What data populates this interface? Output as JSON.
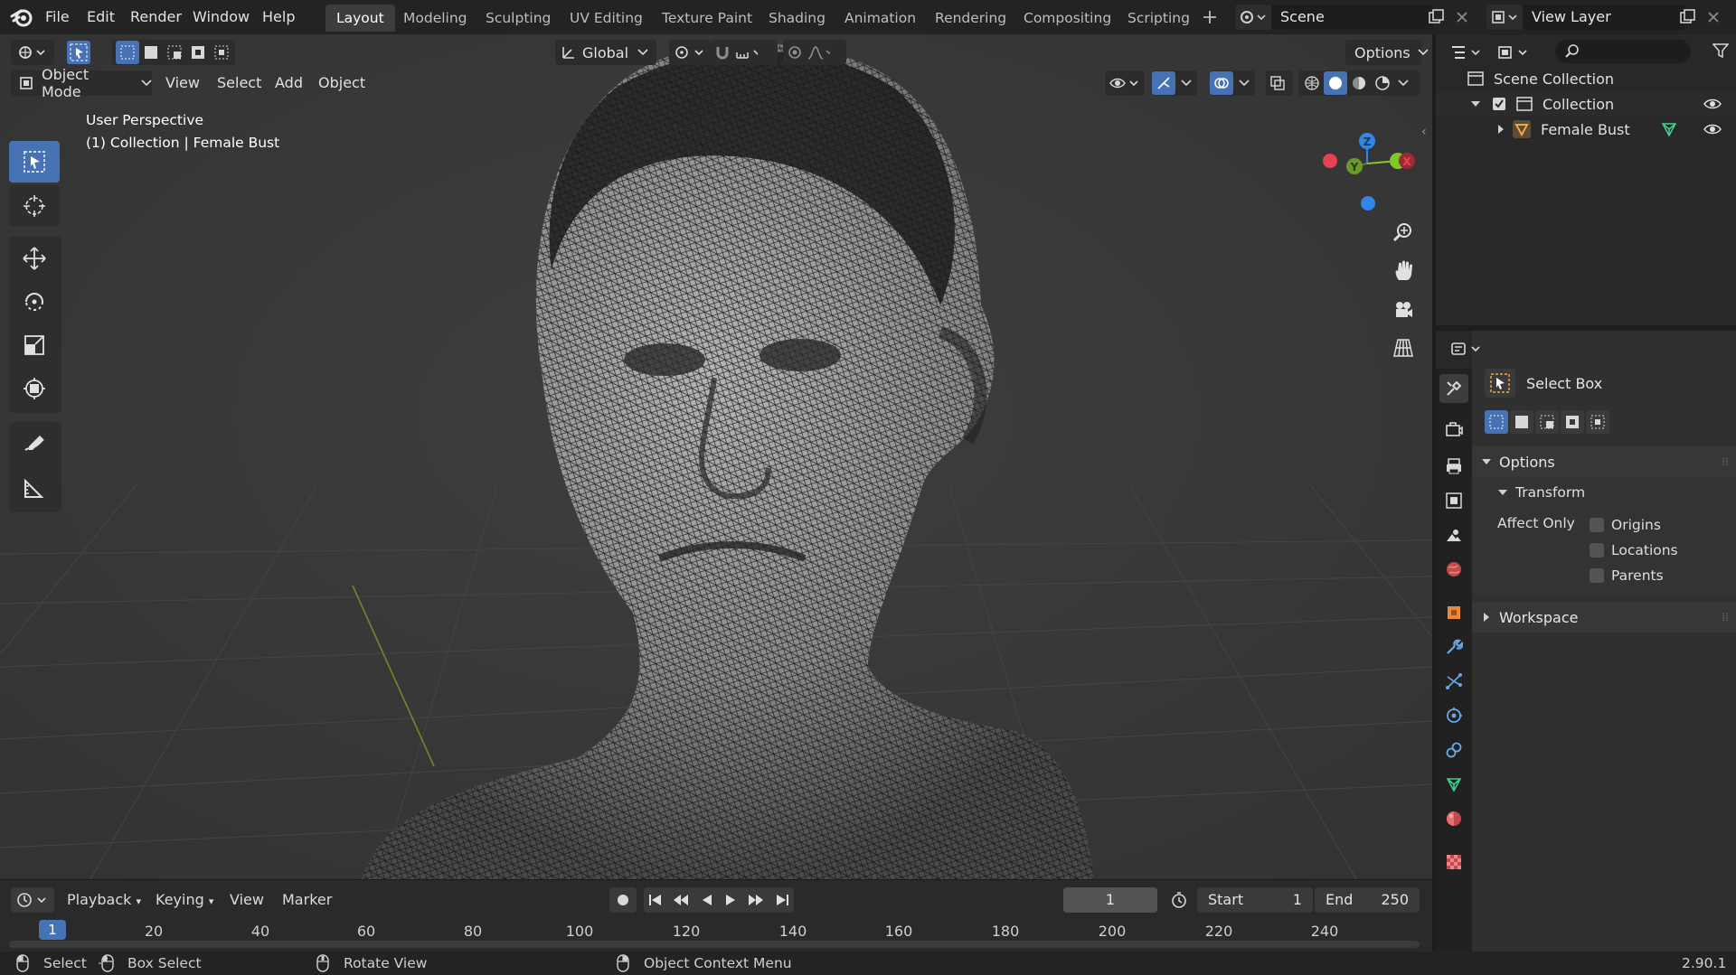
{
  "app": {
    "version": "2.90.1"
  },
  "menu": [
    "File",
    "Edit",
    "Render",
    "Window",
    "Help"
  ],
  "workspaces": [
    {
      "label": "Layout",
      "active": true
    },
    {
      "label": "Modeling",
      "active": false
    },
    {
      "label": "Sculpting",
      "active": false
    },
    {
      "label": "UV Editing",
      "active": false
    },
    {
      "label": "Texture Paint",
      "active": false
    },
    {
      "label": "Shading",
      "active": false
    },
    {
      "label": "Animation",
      "active": false
    },
    {
      "label": "Rendering",
      "active": false
    },
    {
      "label": "Compositing",
      "active": false
    },
    {
      "label": "Scripting",
      "active": false
    }
  ],
  "scene": {
    "name": "Scene"
  },
  "view_layer": {
    "name": "View Layer"
  },
  "viewport": {
    "mode": "Object Mode",
    "menus": [
      "View",
      "Select",
      "Add",
      "Object"
    ],
    "orientation": "Global",
    "options_label": "Options",
    "info_line1": "User Perspective",
    "info_line2": "(1) Collection | Female Bust",
    "gizmo_axes": [
      "Z",
      "Y",
      "X"
    ],
    "object": "Female Bust (wireframe mesh)"
  },
  "timeline": {
    "menus": [
      "Playback",
      "Keying",
      "View",
      "Marker"
    ],
    "current_frame": "1",
    "start_label": "Start",
    "start": "1",
    "end_label": "End",
    "end": "250",
    "ruler": [
      "20",
      "40",
      "60",
      "80",
      "100",
      "120",
      "140",
      "160",
      "180",
      "200",
      "220",
      "240"
    ],
    "marker": "1"
  },
  "status": {
    "select": "Select",
    "box_select": "Box Select",
    "rotate": "Rotate View",
    "context": "Object Context Menu"
  },
  "outliner": {
    "scene_collection": "Scene Collection",
    "collection": "Collection",
    "object": "Female Bust"
  },
  "properties": {
    "tool_name": "Select Box",
    "options_panel": "Options",
    "transform_sub": "Transform",
    "affect_only": "Affect Only",
    "checks": [
      "Origins",
      "Locations",
      "Parents"
    ],
    "workspace_panel": "Workspace"
  },
  "colors": {
    "accent": "#4772b3",
    "axis_x": "#e8414f",
    "axis_y": "#82c62a",
    "axis_z": "#2f86e6"
  }
}
